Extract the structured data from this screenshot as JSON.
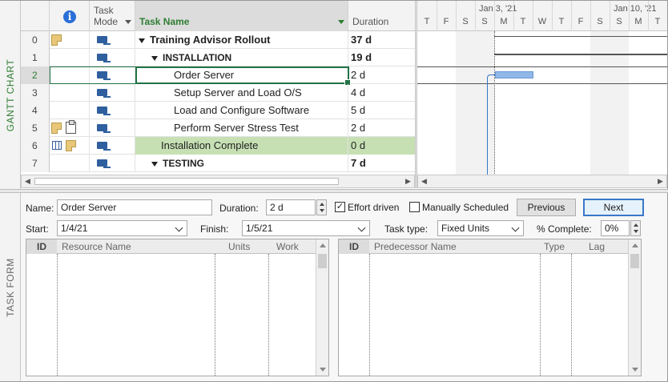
{
  "views": {
    "top_label": "GANTT CHART",
    "bottom_label": "TASK FORM"
  },
  "gantt_table": {
    "columns": {
      "info_icon": "i",
      "mode_line1": "Task",
      "mode_line2": "Mode",
      "name": "Task Name",
      "duration": "Duration"
    },
    "rows": [
      {
        "num": "0",
        "name": "Training Advisor Rollout",
        "duration": "37 d"
      },
      {
        "num": "1",
        "name": "INSTALLATION",
        "duration": "19 d"
      },
      {
        "num": "2",
        "name": "Order Server",
        "duration": "2 d"
      },
      {
        "num": "3",
        "name": "Setup Server and Load O/S",
        "duration": "4 d"
      },
      {
        "num": "4",
        "name": "Load and Configure Software",
        "duration": "5 d"
      },
      {
        "num": "5",
        "name": "Perform Server Stress Test",
        "duration": "2 d"
      },
      {
        "num": "6",
        "name": "Installation Complete",
        "duration": "0 d"
      },
      {
        "num": "7",
        "name": "TESTING",
        "duration": "7 d"
      }
    ]
  },
  "timescale": {
    "weeks": [
      "Jan 3, '21",
      "Jan 10, '21"
    ],
    "days": [
      "T",
      "F",
      "S",
      "S",
      "M",
      "T",
      "W",
      "T",
      "F",
      "S",
      "S",
      "M",
      "T"
    ]
  },
  "task_form": {
    "name_label": "Name:",
    "name_value": "Order Server",
    "duration_label": "Duration:",
    "duration_value": "2 d",
    "effort_driven_label": "Effort driven",
    "effort_driven_checked": true,
    "manually_scheduled_label": "Manually Scheduled",
    "manually_scheduled_checked": false,
    "previous_label": "Previous",
    "next_label": "Next",
    "start_label": "Start:",
    "start_value": "1/4/21",
    "finish_label": "Finish:",
    "finish_value": "1/5/21",
    "task_type_label": "Task type:",
    "task_type_value": "Fixed Units",
    "percent_complete_label": "% Complete:",
    "percent_complete_value": "0%",
    "resources_table": {
      "id": "ID",
      "resource_name": "Resource Name",
      "units": "Units",
      "work": "Work"
    },
    "predecessors_table": {
      "id": "ID",
      "predecessor_name": "Predecessor Name",
      "type": "Type",
      "lag": "Lag"
    }
  },
  "colors": {
    "accent": "#2e7d32",
    "selection": "#217346",
    "milestone_highlight": "#c6e0b4",
    "bar": "#8fb8e8"
  },
  "icons": [
    "info-icon",
    "note-icon",
    "attachment-icon",
    "calendar-icon",
    "auto-scheduled-task-icon",
    "collapse-triangle-icon"
  ]
}
